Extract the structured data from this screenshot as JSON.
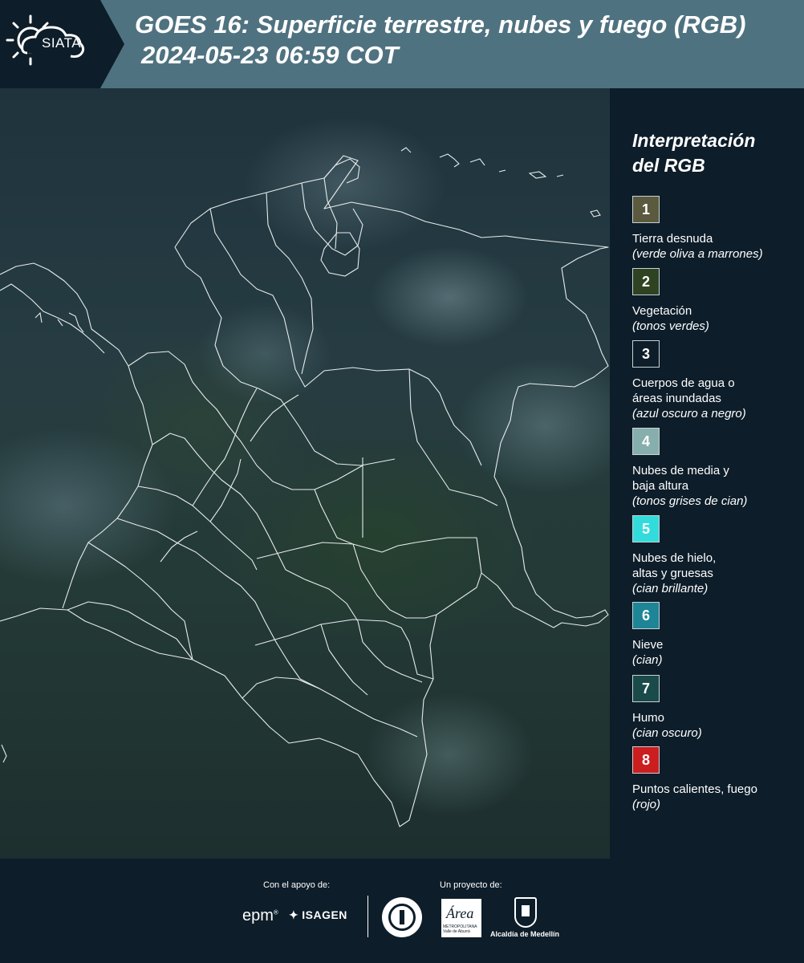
{
  "header": {
    "logo_text": "SIATA",
    "title_line1": "GOES 16: Superficie terrestre, nubes y fuego (RGB)",
    "title_line2": "2024-05-23 06:59 COT"
  },
  "legend": {
    "title_line1": "Interpretación",
    "title_line2": "del RGB",
    "items": [
      {
        "number": "1",
        "color": "#5b5a3e",
        "label": "Tierra desnuda",
        "note": "(verde oliva a marrones)"
      },
      {
        "number": "2",
        "color": "#2f4322",
        "label": "Vegetación",
        "note": "(tonos verdes)"
      },
      {
        "number": "3",
        "color": "#0d1d29",
        "label": "Cuerpos de agua o",
        "label2": "áreas inundadas",
        "note": "(azul oscuro a negro)"
      },
      {
        "number": "4",
        "color": "#86aead",
        "label": "Nubes de media y",
        "label2": "baja altura",
        "note": "(tonos grises de cian)"
      },
      {
        "number": "5",
        "color": "#33dcdc",
        "label": "Nubes de hielo,",
        "label2": "altas y gruesas",
        "note": "(cian brillante)"
      },
      {
        "number": "6",
        "color": "#1e8596",
        "label": "Nieve",
        "note": "(cian)"
      },
      {
        "number": "7",
        "color": "#1b4a4a",
        "label": "Humo",
        "note": "(cian oscuro)"
      },
      {
        "number": "8",
        "color": "#cc1d1f",
        "label": "Puntos calientes, fuego",
        "note": "(rojo)"
      }
    ]
  },
  "footer": {
    "support_label": "Con el apoyo de:",
    "project_label": "Un proyecto de:",
    "epm": "epm",
    "epm_mark": "®",
    "isagen": "ISAGEN",
    "area_word": "Área",
    "area_sub": "METROPOLITANA Valle de Aburrá",
    "alcaldia": "Alcaldía de Medellín"
  }
}
